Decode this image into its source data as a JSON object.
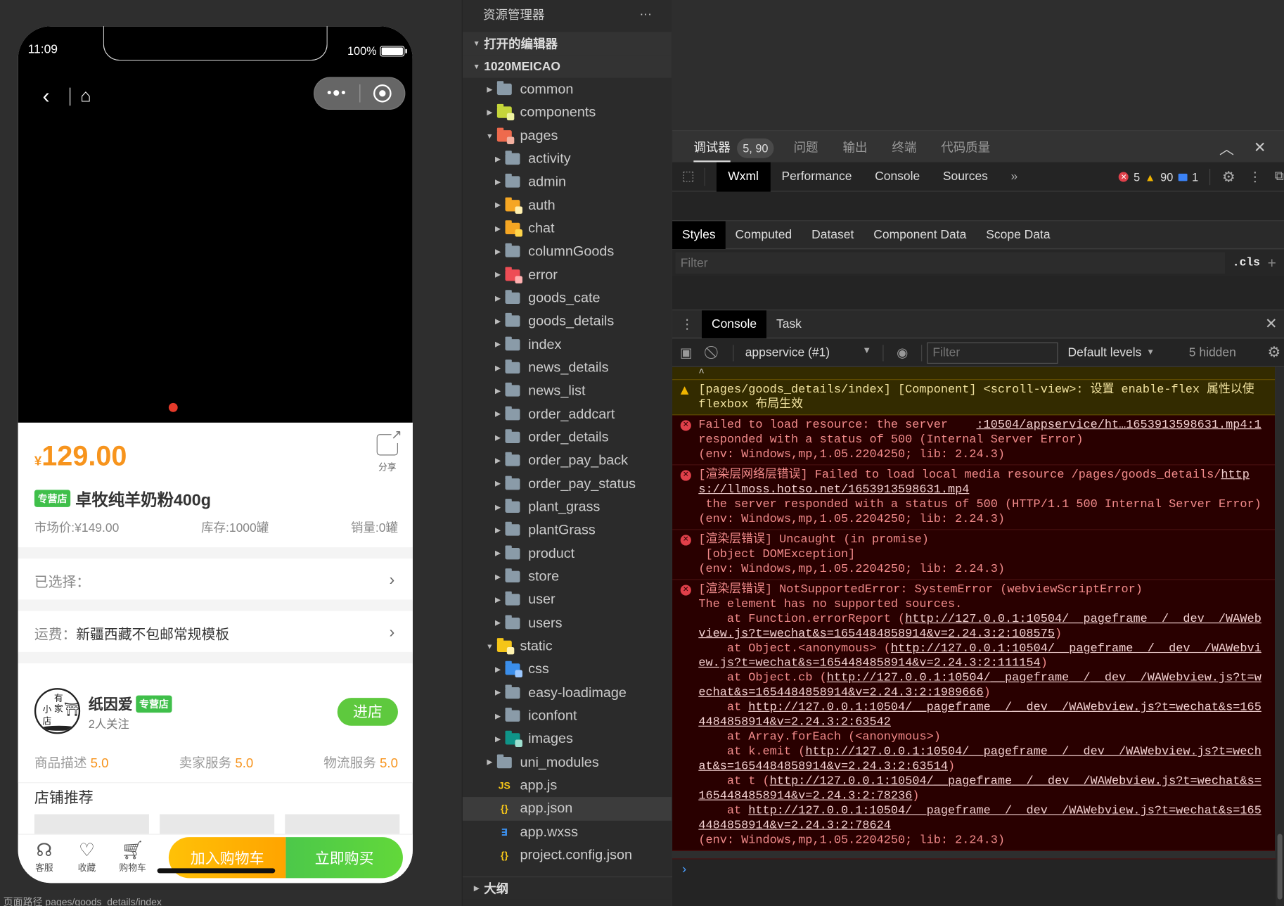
{
  "simulator": {
    "status": {
      "time": "11:09",
      "battery": "100%"
    },
    "nav": {
      "back_icon": "‹",
      "home_icon": "⌂",
      "more_icon": "•●•"
    },
    "carousel": {
      "active_dot": 1,
      "dot_color": "#e53a2a"
    },
    "product": {
      "currency": "¥",
      "price": "129.00",
      "share_label": "分享",
      "tag": "专营店",
      "title": "卓牧纯羊奶粉400g",
      "market_price": "市场价:¥149.00",
      "stock": "库存:1000罐",
      "sales": "销量:0罐"
    },
    "selected": {
      "label": "已选择："
    },
    "shipping": {
      "label": "运费：",
      "value": "新疆西藏不包邮常规模板"
    },
    "shop": {
      "logo_chars": [
        "有",
        "家",
        "小",
        "店"
      ],
      "name": "纸因爱",
      "tag": "专营店",
      "followers": "2人关注",
      "enter_label": "进店",
      "scores": [
        {
          "label": "商品描述",
          "value": "5.0"
        },
        {
          "label": "卖家服务",
          "value": "5.0"
        },
        {
          "label": "物流服务",
          "value": "5.0"
        }
      ]
    },
    "recommend": {
      "title": "店铺推荐"
    },
    "bottom_bar": {
      "icons": [
        {
          "label": "客服",
          "icon": "headset-icon"
        },
        {
          "label": "收藏",
          "icon": "heart-icon"
        },
        {
          "label": "购物车",
          "icon": "cart-icon"
        }
      ],
      "add_cart_label": "加入购物车",
      "buy_now_label": "立即购买"
    },
    "bottom_status": "页面路径   pages/goods_details/index"
  },
  "explorer": {
    "title": "资源管理器",
    "more_icon": "···",
    "open_editors": "打开的编辑器",
    "project": "1020MEICAO",
    "tree": [
      {
        "name": "common",
        "depth": 1,
        "type": "folder",
        "color": "#8a9ba8",
        "expanded": false
      },
      {
        "name": "components",
        "depth": 1,
        "type": "folder",
        "color": "#c5d63a",
        "badge": "#eef3a0",
        "expanded": false
      },
      {
        "name": "pages",
        "depth": 1,
        "type": "folder",
        "color": "#ee6a4d",
        "badge": "#f3b0a0",
        "expanded": true
      },
      {
        "name": "activity",
        "depth": 2,
        "type": "folder",
        "color": "#8a9ba8",
        "expanded": false
      },
      {
        "name": "admin",
        "depth": 2,
        "type": "folder",
        "color": "#8a9ba8",
        "expanded": false
      },
      {
        "name": "auth",
        "depth": 2,
        "type": "folder",
        "color": "#f5a623",
        "badge": "#fff0b0",
        "expanded": false
      },
      {
        "name": "chat",
        "depth": 2,
        "type": "folder",
        "color": "#f5a623",
        "badge": "#ffd54a",
        "expanded": false
      },
      {
        "name": "columnGoods",
        "depth": 2,
        "type": "folder",
        "color": "#8a9ba8",
        "expanded": false
      },
      {
        "name": "error",
        "depth": 2,
        "type": "folder",
        "color": "#ee4d55",
        "badge": "#ffb0b0",
        "expanded": false
      },
      {
        "name": "goods_cate",
        "depth": 2,
        "type": "folder",
        "color": "#8a9ba8",
        "expanded": false
      },
      {
        "name": "goods_details",
        "depth": 2,
        "type": "folder",
        "color": "#8a9ba8",
        "expanded": false
      },
      {
        "name": "index",
        "depth": 2,
        "type": "folder",
        "color": "#8a9ba8",
        "expanded": false
      },
      {
        "name": "news_details",
        "depth": 2,
        "type": "folder",
        "color": "#8a9ba8",
        "expanded": false
      },
      {
        "name": "news_list",
        "depth": 2,
        "type": "folder",
        "color": "#8a9ba8",
        "expanded": false
      },
      {
        "name": "order_addcart",
        "depth": 2,
        "type": "folder",
        "color": "#8a9ba8",
        "expanded": false
      },
      {
        "name": "order_details",
        "depth": 2,
        "type": "folder",
        "color": "#8a9ba8",
        "expanded": false
      },
      {
        "name": "order_pay_back",
        "depth": 2,
        "type": "folder",
        "color": "#8a9ba8",
        "expanded": false
      },
      {
        "name": "order_pay_status",
        "depth": 2,
        "type": "folder",
        "color": "#8a9ba8",
        "expanded": false
      },
      {
        "name": "plant_grass",
        "depth": 2,
        "type": "folder",
        "color": "#8a9ba8",
        "expanded": false
      },
      {
        "name": "plantGrass",
        "depth": 2,
        "type": "folder",
        "color": "#8a9ba8",
        "expanded": false
      },
      {
        "name": "product",
        "depth": 2,
        "type": "folder",
        "color": "#8a9ba8",
        "expanded": false
      },
      {
        "name": "store",
        "depth": 2,
        "type": "folder",
        "color": "#8a9ba8",
        "expanded": false
      },
      {
        "name": "user",
        "depth": 2,
        "type": "folder",
        "color": "#8a9ba8",
        "expanded": false
      },
      {
        "name": "users",
        "depth": 2,
        "type": "folder",
        "color": "#8a9ba8",
        "expanded": false
      },
      {
        "name": "static",
        "depth": 1,
        "type": "folder",
        "color": "#f5c518",
        "badge": "#fff3b0",
        "expanded": true
      },
      {
        "name": "css",
        "depth": 2,
        "type": "folder",
        "color": "#3b8eea",
        "badge": "#9cc8ff",
        "expanded": false
      },
      {
        "name": "easy-loadimage",
        "depth": 2,
        "type": "folder",
        "color": "#8a9ba8",
        "expanded": false
      },
      {
        "name": "iconfont",
        "depth": 2,
        "type": "folder",
        "color": "#8a9ba8",
        "expanded": false
      },
      {
        "name": "images",
        "depth": 2,
        "type": "folder",
        "color": "#0f9488",
        "badge": "#9fe0d0",
        "expanded": false
      },
      {
        "name": "uni_modules",
        "depth": 1,
        "type": "folder",
        "color": "#8a9ba8",
        "expanded": false
      },
      {
        "name": "app.js",
        "depth": 1,
        "type": "file",
        "icon": "JS",
        "color": "#f5c518"
      },
      {
        "name": "app.json",
        "depth": 1,
        "type": "file",
        "icon": "{}",
        "color": "#f5c518",
        "selected": true
      },
      {
        "name": "app.wxss",
        "depth": 1,
        "type": "file",
        "icon": "∃",
        "color": "#3b8eea"
      },
      {
        "name": "project.config.json",
        "depth": 1,
        "type": "file",
        "icon": "{}",
        "color": "#f5c518"
      }
    ],
    "outline": "大纲"
  },
  "debugger": {
    "tabs": [
      {
        "label": "调试器",
        "active": true,
        "badge": "5, 90"
      },
      {
        "label": "问题"
      },
      {
        "label": "输出"
      },
      {
        "label": "终端"
      },
      {
        "label": "代码质量"
      }
    ],
    "collapse_icon": "︿",
    "close_icon": "✕",
    "tool_tabs": [
      "Wxml",
      "Performance",
      "Console",
      "Sources"
    ],
    "active_tool_tab": "Wxml",
    "more_tabs_icon": "»",
    "counts": {
      "errors": "5",
      "warnings": "90",
      "info": "1"
    },
    "style_tabs": [
      "Styles",
      "Computed",
      "Dataset",
      "Component Data",
      "Scope Data"
    ],
    "active_style_tab": "Styles",
    "styles_filter_placeholder": "Filter",
    "cls_label": ".cls",
    "add_icon": "+",
    "drawer_tabs": [
      "Console",
      "Task"
    ],
    "context": "appservice (#1)",
    "console_filter_placeholder": "Filter",
    "levels": "Default levels",
    "hidden": "5 hidden",
    "messages": [
      {
        "level": "warn",
        "parts": [
          {
            "t": "[pages/goods_details/index] [Component] <scroll-view>: 设置 enable-flex 属性以使 flexbox 布局生效"
          }
        ]
      },
      {
        "level": "err",
        "parts": [
          {
            "t": "Failed to load resource: the server    "
          },
          {
            "t": ":10504/appservice/ht…1653913598631.mp4:1",
            "link": true
          },
          {
            "t": "\nresponded with a status of 500 (Internal Server Error)\n(env: Windows,mp,1.05.2204250; lib: 2.24.3)"
          }
        ]
      },
      {
        "level": "err",
        "parts": [
          {
            "t": "[渲染层网络层错误] Failed to load local media resource /pages/goods_details/"
          },
          {
            "t": "https://llmoss.hotso.net/1653913598631.mp4",
            "link": true
          },
          {
            "t": "\n the server responded with a status of 500 (HTTP/1.1 500 Internal Server Error)\n(env: Windows,mp,1.05.2204250; lib: 2.24.3)"
          }
        ]
      },
      {
        "level": "err",
        "parts": [
          {
            "t": "[渲染层错误] Uncaught (in promise)\n [object DOMException]\n(env: Windows,mp,1.05.2204250; lib: 2.24.3)"
          }
        ]
      },
      {
        "level": "err",
        "parts": [
          {
            "t": "[渲染层错误] NotSupportedError: SystemError (webviewScriptError)\nThe element has no supported sources.\n    at Function.errorReport ("
          },
          {
            "t": "http://127.0.0.1:10504/__pageframe__/__dev__/WAWebview.js?t=wechat&s=1654484858914&v=2.24.3:2:108575",
            "link": true
          },
          {
            "t": ")\n    at Object.<anonymous> ("
          },
          {
            "t": "http://127.0.0.1:10504/__pageframe__/__dev__/WAWebview.js?t=wechat&s=1654484858914&v=2.24.3:2:111154",
            "link": true
          },
          {
            "t": ")\n    at Object.cb ("
          },
          {
            "t": "http://127.0.0.1:10504/__pageframe__/__dev__/WAWebview.js?t=wechat&s=1654484858914&v=2.24.3:2:1989666",
            "link": true
          },
          {
            "t": ")\n    at "
          },
          {
            "t": "http://127.0.0.1:10504/__pageframe__/__dev__/WAWebview.js?t=wechat&s=1654484858914&v=2.24.3:2:63542",
            "link": true
          },
          {
            "t": "\n    at Array.forEach (<anonymous>)\n    at k.emit ("
          },
          {
            "t": "http://127.0.0.1:10504/__pageframe__/__dev__/WAWebview.js?t=wechat&s=1654484858914&v=2.24.3:2:63514",
            "link": true
          },
          {
            "t": ")\n    at t ("
          },
          {
            "t": "http://127.0.0.1:10504/__pageframe__/__dev__/WAWebview.js?t=wechat&s=1654484858914&v=2.24.3:2:78236",
            "link": true
          },
          {
            "t": ")\n    at "
          },
          {
            "t": "http://127.0.0.1:10504/__pageframe__/__dev__/WAWebview.js?t=wechat&s=1654484858914&v=2.24.3:2:78624",
            "link": true
          },
          {
            "t": "\n(env: Windows,mp,1.05.2204250; lib: 2.24.3)"
          }
        ]
      }
    ],
    "prompt_icon": "›"
  }
}
